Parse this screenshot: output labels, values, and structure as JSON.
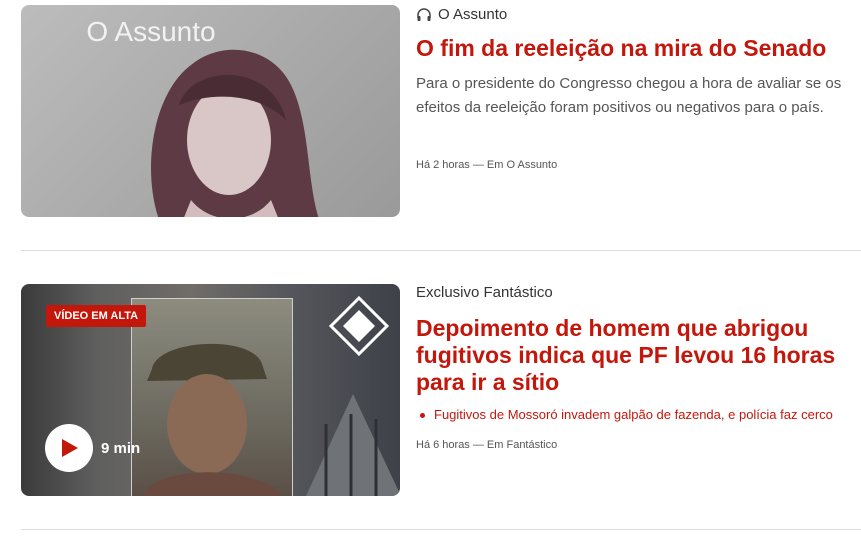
{
  "articles": [
    {
      "kicker": "O Assunto",
      "kicker_icon": "headphones-icon",
      "thumbnail_title": "O Assunto",
      "headline": "O fim da reeleição na mira do Senado",
      "summary": "Para o presidente do Congresso chegou a hora de avaliar se os efeitos da reeleição foram positivos ou negativos para o país.",
      "meta": "Há 2 horas — Em O Assunto"
    },
    {
      "kicker": "Exclusivo Fantástico",
      "badge": "VÍDEO EM ALTA",
      "duration": "9 min",
      "headline": "Depoimento de homem que abrigou fugitivos indica que PF levou 16 horas para ir a sítio",
      "related": "Fugitivos de Mossoró invadem galpão de fazenda, e polícia faz cerco",
      "meta": "Há 6 horas — Em Fantástico"
    }
  ],
  "colors": {
    "accent": "#c4170c",
    "text_muted": "#555555",
    "divider": "#dcdcdc"
  }
}
